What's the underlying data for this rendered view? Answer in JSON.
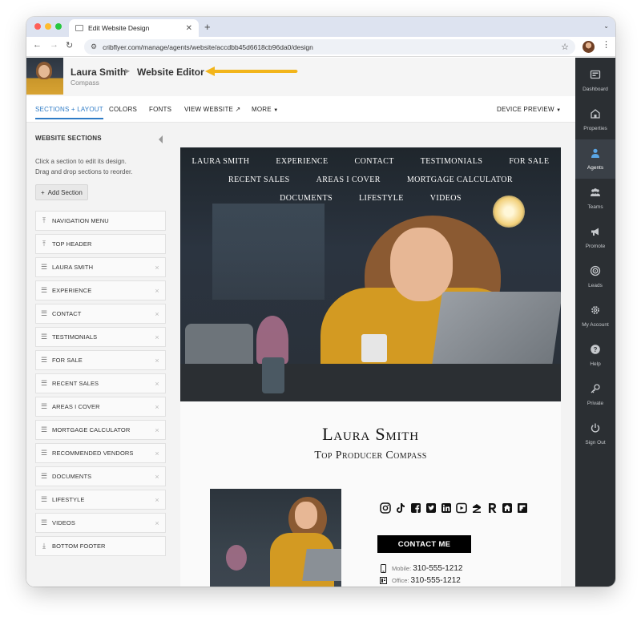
{
  "browser": {
    "tab_title": "Edit Website Design",
    "new_tab": "+",
    "url": "cribflyer.com/manage/agents/website/accdbb45d6618cb96da0/design"
  },
  "header": {
    "agent_name": "Laura Smith",
    "editor_title": "Website Editor",
    "company": "Compass"
  },
  "subnav": {
    "sections_layout": "SECTIONS + LAYOUT",
    "colors": "COLORS",
    "fonts": "FONTS",
    "view_website": "VIEW WEBSITE",
    "more": "MORE",
    "device_preview": "DEVICE PREVIEW"
  },
  "left_panel": {
    "title": "WEBSITE SECTIONS",
    "help_line1": "Click a section to edit its design.",
    "help_line2": "Drag and drop sections to reorder.",
    "add_section": "Add Section",
    "sections": [
      {
        "label": "NAVIGATION MENU",
        "icon": "pin-top-icon",
        "removable": false
      },
      {
        "label": "TOP HEADER",
        "icon": "pin-top-icon",
        "removable": false
      },
      {
        "label": "LAURA SMITH",
        "icon": "drag-handle-icon",
        "removable": true
      },
      {
        "label": "EXPERIENCE",
        "icon": "drag-handle-icon",
        "removable": true
      },
      {
        "label": "CONTACT",
        "icon": "drag-handle-icon",
        "removable": true
      },
      {
        "label": "TESTIMONIALS",
        "icon": "drag-handle-icon",
        "removable": true
      },
      {
        "label": "FOR SALE",
        "icon": "drag-handle-icon",
        "removable": true
      },
      {
        "label": "RECENT SALES",
        "icon": "drag-handle-icon",
        "removable": true
      },
      {
        "label": "AREAS I COVER",
        "icon": "drag-handle-icon",
        "removable": true
      },
      {
        "label": "MORTGAGE CALCULATOR",
        "icon": "drag-handle-icon",
        "removable": true
      },
      {
        "label": "RECOMMENDED VENDORS",
        "icon": "drag-handle-icon",
        "removable": true
      },
      {
        "label": "DOCUMENTS",
        "icon": "drag-handle-icon",
        "removable": true
      },
      {
        "label": "LIFESTYLE",
        "icon": "drag-handle-icon",
        "removable": true
      },
      {
        "label": "VIDEOS",
        "icon": "drag-handle-icon",
        "removable": true
      },
      {
        "label": "BOTTOM FOOTER",
        "icon": "pin-bottom-icon",
        "removable": false
      }
    ]
  },
  "preview": {
    "nav_rows": [
      [
        "LAURA SMITH",
        "EXPERIENCE",
        "CONTACT",
        "TESTIMONIALS",
        "FOR SALE"
      ],
      [
        "RECENT SALES",
        "AREAS I COVER",
        "MORTGAGE CALCULATOR"
      ],
      [
        "DOCUMENTS",
        "LIFESTYLE",
        "VIDEOS"
      ]
    ],
    "name": "Laura Smith",
    "tagline": "Top Producer Compass",
    "social_icons": [
      "instagram-icon",
      "tiktok-icon",
      "facebook-icon",
      "twitter-icon",
      "linkedin-icon",
      "youtube-icon",
      "zillow-icon",
      "realtor-icon",
      "homes-icon",
      "flipboard-icon"
    ],
    "contact_button": "CONTACT ME",
    "mobile_label": "Mobile:",
    "mobile": "310-555-1212",
    "office_label": "Office:",
    "office": "310-555-1212"
  },
  "sidebar": {
    "items": [
      {
        "label": "Dashboard",
        "icon": "dashboard-icon"
      },
      {
        "label": "Properties",
        "icon": "properties-icon"
      },
      {
        "label": "Agents",
        "icon": "agent-icon"
      },
      {
        "label": "Teams",
        "icon": "teams-icon"
      },
      {
        "label": "Promote",
        "icon": "megaphone-icon"
      },
      {
        "label": "Leads",
        "icon": "target-icon"
      },
      {
        "label": "My Account",
        "icon": "gear-icon"
      },
      {
        "label": "Help",
        "icon": "help-icon"
      },
      {
        "label": "Private",
        "icon": "key-icon"
      },
      {
        "label": "Sign Out",
        "icon": "power-icon"
      }
    ],
    "active": "Agents"
  },
  "colors": {
    "accent": "#2e7bc6",
    "sidebar_bg": "#2b2f33",
    "arrow": "#f2b51b",
    "button_black": "#000000"
  }
}
